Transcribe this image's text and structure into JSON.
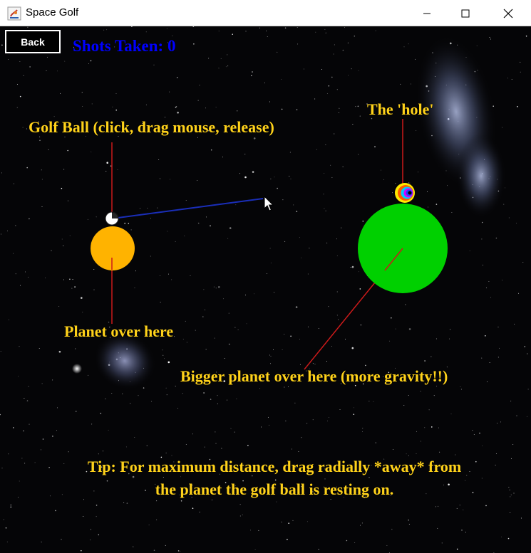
{
  "window": {
    "title": "Space Golf"
  },
  "controls": {
    "back_label": "Back",
    "shots_label": "Shots Taken: 0"
  },
  "labels": {
    "golf_ball": "Golf Ball (click, drag mouse, release)",
    "hole": "The 'hole'",
    "planet": "Planet over here",
    "bigger_planet": "Bigger planet over here (more gravity!!)"
  },
  "tip": {
    "line1": "Tip: For maximum distance, drag radially *away* from",
    "line2": "the planet the golf ball is resting on."
  },
  "colors": {
    "label": "#ffd21a",
    "shots": "#0000ff",
    "small_planet": "#ffb300",
    "big_planet": "#00d000",
    "pointer_lines": "#cc1a1a",
    "aim_line": "#1a2eb8",
    "ball": "#ffffff"
  },
  "icons": {
    "app": "java-app-icon",
    "minimize": "minimize-icon",
    "maximize": "maximize-icon",
    "close": "close-icon",
    "cursor": "mouse-cursor-icon"
  }
}
